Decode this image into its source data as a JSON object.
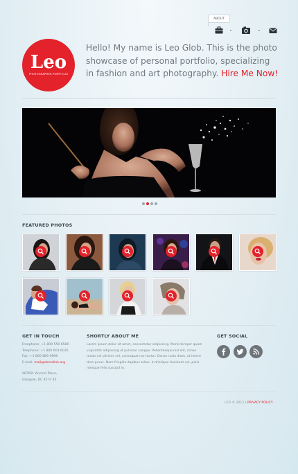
{
  "nav": {
    "about_label": "ABOUT",
    "icons": [
      "briefcase-icon",
      "camera-icon",
      "mail-icon"
    ]
  },
  "logo": {
    "name": "Leo",
    "tagline": "PHOTOGRAPHER PORTFOLIO",
    "color": "#e3222b"
  },
  "intro": {
    "text": "Hello! My name is Leo Glob. This is the photo showcase of personal portfolio, specializing in fashion and art photography.",
    "cta": "Hire Me Now!"
  },
  "slider": {
    "active_index": 1,
    "count": 4
  },
  "featured": {
    "title": "FEATURED PHOTOS",
    "thumb_count": 10
  },
  "contact": {
    "title": "GET IN TOUCH",
    "freephone": "Freephone: +1 800 559 6580",
    "telephone": "Telephone: +1 800 603 6035",
    "fax": "Fax: +1 800 889 9898",
    "email_label": "E-mail:",
    "email": "mail@demolink.org",
    "address_line1": "9870St Vincent Place,",
    "address_line2": "Glasgow, DC 45 Fr 45."
  },
  "about": {
    "title": "SHORTLY ABOUT ME",
    "lines": [
      "Lorem ipsum dolor sit amet, consectetur adipiscing. Morbi tempor quam",
      "vulputate adipiscing ut pulvinar congue. Pellentesque nisl elit, conse",
      "modo vel ultrices vel, consequat non tortor. Donec nulla diam, ut interd",
      "dum purus. Nam fringilla dapibus tellus. In tristique tincidunt vel, pelle",
      "ntesque felis suscipit in."
    ]
  },
  "social": {
    "title": "GET SOCIAL",
    "icons": [
      "facebook-icon",
      "twitter-icon",
      "rss-icon"
    ]
  },
  "footer": {
    "copyright": "LEO © 2012",
    "separator": "|",
    "privacy": "PRIVACY POLICY"
  }
}
